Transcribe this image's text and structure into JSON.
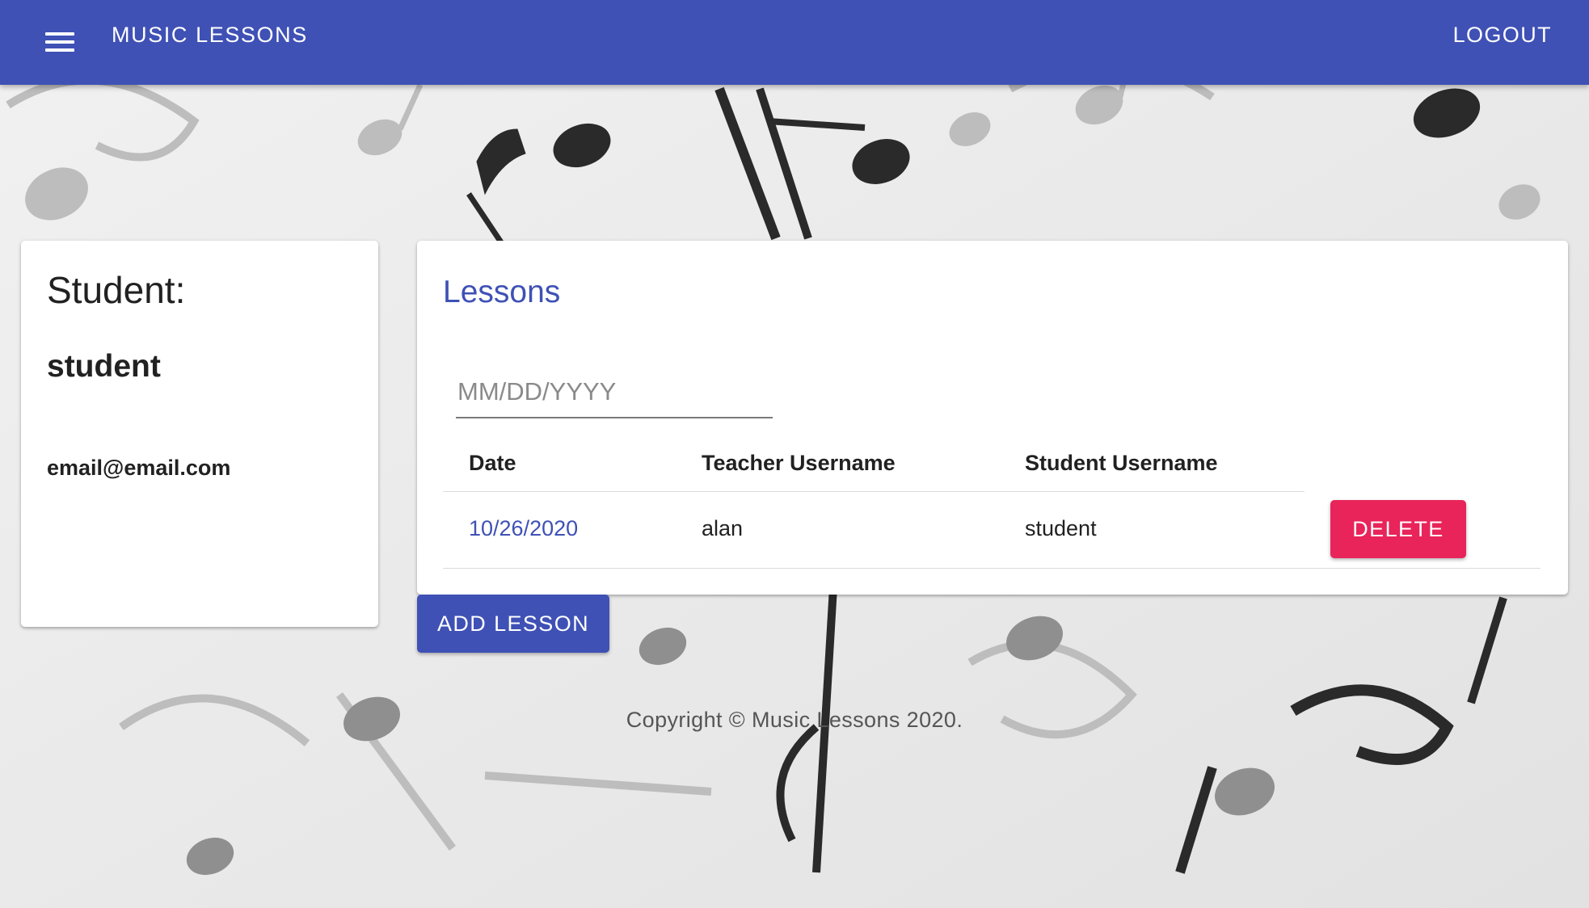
{
  "appbar": {
    "menu_icon": "menu-icon",
    "title": "MUSIC LESSONS",
    "logout_label": "LOGOUT",
    "color": "#3f51b5"
  },
  "student_card": {
    "role_label": "Student:",
    "username": "student",
    "email": "email@email.com"
  },
  "lessons": {
    "title": "Lessons",
    "date_filter": {
      "value": "",
      "placeholder": "MM/DD/YYYY"
    },
    "columns": [
      "Date",
      "Teacher Username",
      "Student Username"
    ],
    "rows": [
      {
        "date": "10/26/2020",
        "teacher": "alan",
        "student": "student",
        "action_label": "DELETE"
      }
    ],
    "add_label": "ADD LESSON"
  },
  "footer": {
    "text": "Copyright © Music Lessons 2020."
  },
  "colors": {
    "primary": "#3f51b5",
    "danger": "#e8245a",
    "text": "#212121"
  }
}
